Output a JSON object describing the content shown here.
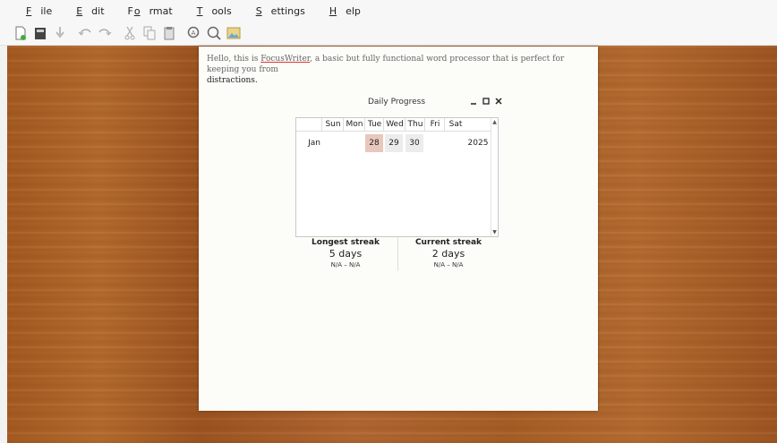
{
  "menu": [
    {
      "pre": "",
      "u": "F",
      "post": "ile"
    },
    {
      "pre": "",
      "u": "E",
      "post": "dit"
    },
    {
      "pre": "F",
      "u": "o",
      "post": "rmat"
    },
    {
      "pre": "",
      "u": "T",
      "post": "ools"
    },
    {
      "pre": "",
      "u": "S",
      "post": "ettings"
    },
    {
      "pre": "",
      "u": "H",
      "post": "elp"
    }
  ],
  "document": {
    "line1_a": "Hello, this is ",
    "line1_misspelled": "FocusWriter",
    "line1_b": ", a basic but fully functional word processor that is perfect for keeping you from",
    "line2": "distractions."
  },
  "dialog": {
    "title": "Daily Progress",
    "weekdays": [
      "Sun",
      "Mon",
      "Tue",
      "Wed",
      "Thu",
      "Fri",
      "Sat"
    ],
    "month": "Jan",
    "year": "2025",
    "days": [
      {
        "label": "28",
        "weekday": "Tue",
        "highlight": "#e8c7bc"
      },
      {
        "label": "29",
        "weekday": "Wed",
        "highlight": "#ececec"
      },
      {
        "label": "30",
        "weekday": "Thu",
        "highlight": "#ececec"
      }
    ],
    "longest": {
      "label": "Longest streak",
      "value": "5 days",
      "range": "N/A – N/A"
    },
    "current": {
      "label": "Current streak",
      "value": "2 days",
      "range": "N/A – N/A"
    }
  }
}
